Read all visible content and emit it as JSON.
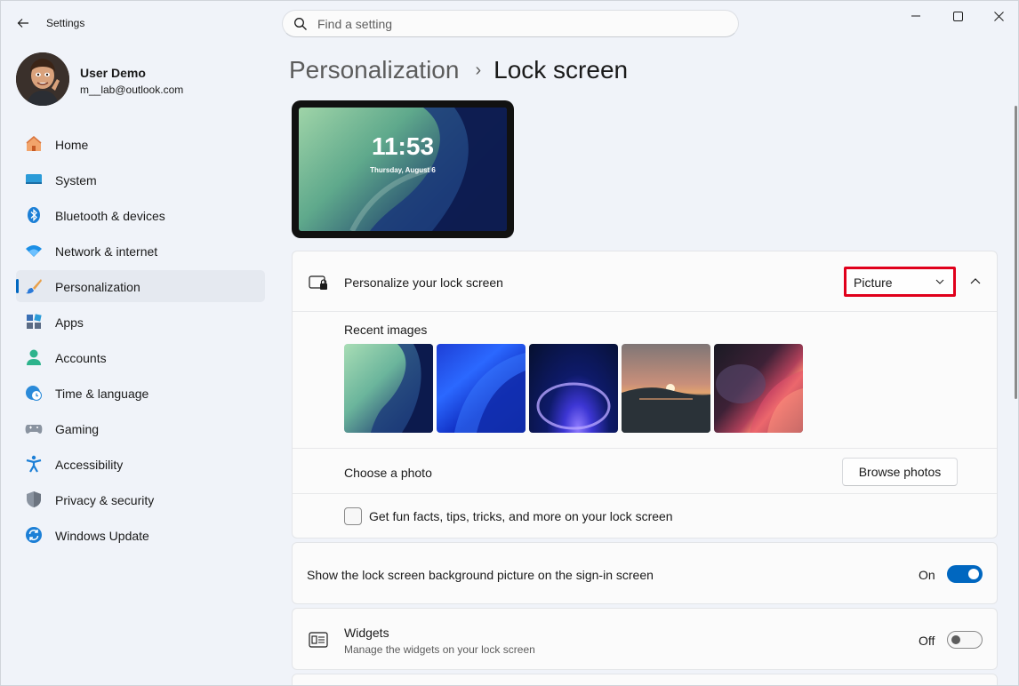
{
  "window": {
    "title": "Settings"
  },
  "search": {
    "placeholder": "Find a setting"
  },
  "user": {
    "name": "User Demo",
    "email": "m__lab@outlook.com"
  },
  "nav": {
    "items": [
      {
        "label": "Home",
        "icon": "home-icon"
      },
      {
        "label": "System",
        "icon": "system-icon"
      },
      {
        "label": "Bluetooth & devices",
        "icon": "bluetooth-icon"
      },
      {
        "label": "Network & internet",
        "icon": "wifi-icon"
      },
      {
        "label": "Personalization",
        "icon": "brush-icon",
        "active": true
      },
      {
        "label": "Apps",
        "icon": "apps-icon"
      },
      {
        "label": "Accounts",
        "icon": "accounts-icon"
      },
      {
        "label": "Time & language",
        "icon": "clock-globe-icon"
      },
      {
        "label": "Gaming",
        "icon": "gamepad-icon"
      },
      {
        "label": "Accessibility",
        "icon": "accessibility-icon"
      },
      {
        "label": "Privacy & security",
        "icon": "shield-icon"
      },
      {
        "label": "Windows Update",
        "icon": "update-icon"
      }
    ]
  },
  "breadcrumb": {
    "parent": "Personalization",
    "separator": "›",
    "current": "Lock screen"
  },
  "preview": {
    "time": "11:53",
    "date": "Thursday, August 6"
  },
  "lock": {
    "personalize_label": "Personalize your lock screen",
    "dropdown_value": "Picture",
    "recent_label": "Recent images",
    "choose_label": "Choose a photo",
    "browse_label": "Browse photos",
    "fun_facts_label": "Get fun facts, tips, tricks, and more on your lock screen",
    "fun_facts_checked": false
  },
  "signin": {
    "label": "Show the lock screen background picture on the sign-in screen",
    "state": "On"
  },
  "widgets": {
    "title": "Widgets",
    "subtitle": "Manage the widgets on your lock screen",
    "state": "Off"
  },
  "colors": {
    "accent": "#0067c0",
    "highlight": "#e0001b"
  }
}
